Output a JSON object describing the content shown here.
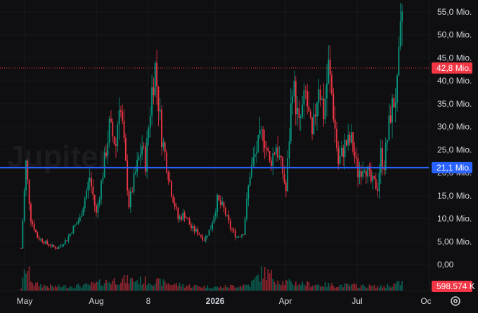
{
  "chart_data": {
    "type": "candlestick",
    "x_ticks": [
      "May",
      "Aug",
      "8",
      "2026",
      "Apr",
      "Jul",
      "Oc"
    ],
    "y_ticks": [
      "55,0 Mio.",
      "50,0 Mio.",
      "45,0 Mio.",
      "40,0 Mio.",
      "35,0 Mio.",
      "30,0 Mio.",
      "25,0 Mio.",
      "20,0 Mio.",
      "15,0 Mio.",
      "10,0 Mio.",
      "5,00 Mio.",
      "0,00"
    ],
    "ylim": [
      -5.5,
      56.5
    ],
    "unit": "Mio.",
    "price_marker": {
      "label": "42,8 Mio.",
      "value": 42.8,
      "color": "#f23645"
    },
    "level_line": {
      "label": "21,1 Mio.",
      "value": 21.1,
      "color": "#2962ff"
    },
    "volume_label": {
      "label": "598.574 K",
      "color": "#f23645"
    },
    "watermark": "Jupiter",
    "up_color": "#089981",
    "down_color": "#f23645",
    "series_anchors": [
      [
        0,
        3.5
      ],
      [
        3,
        22
      ],
      [
        6,
        10
      ],
      [
        10,
        6
      ],
      [
        16,
        4.5
      ],
      [
        22,
        3.5
      ],
      [
        28,
        5.5
      ],
      [
        32,
        8
      ],
      [
        36,
        10
      ],
      [
        42,
        19
      ],
      [
        46,
        11
      ],
      [
        50,
        20
      ],
      [
        54,
        30
      ],
      [
        58,
        26
      ],
      [
        60,
        36
      ],
      [
        62,
        30
      ],
      [
        66,
        13
      ],
      [
        70,
        20
      ],
      [
        74,
        26
      ],
      [
        76,
        22
      ],
      [
        80,
        38
      ],
      [
        82,
        43
      ],
      [
        86,
        28
      ],
      [
        88,
        24
      ],
      [
        92,
        16
      ],
      [
        96,
        10
      ],
      [
        100,
        11
      ],
      [
        104,
        8
      ],
      [
        108,
        7
      ],
      [
        112,
        5.5
      ],
      [
        116,
        8
      ],
      [
        120,
        14
      ],
      [
        124,
        12
      ],
      [
        128,
        8
      ],
      [
        132,
        6
      ],
      [
        136,
        7
      ],
      [
        140,
        20
      ],
      [
        144,
        25
      ],
      [
        148,
        29
      ],
      [
        152,
        22
      ],
      [
        156,
        26
      ],
      [
        160,
        20
      ],
      [
        162,
        16
      ],
      [
        166,
        40
      ],
      [
        170,
        30
      ],
      [
        174,
        37
      ],
      [
        178,
        27
      ],
      [
        182,
        40
      ],
      [
        185,
        33
      ],
      [
        188,
        43
      ],
      [
        190,
        37
      ],
      [
        194,
        22
      ],
      [
        198,
        26
      ],
      [
        202,
        27
      ],
      [
        206,
        20
      ],
      [
        210,
        22
      ],
      [
        214,
        18
      ],
      [
        218,
        17
      ],
      [
        220,
        24
      ],
      [
        222,
        22
      ],
      [
        226,
        33
      ],
      [
        230,
        38
      ],
      [
        233,
        55
      ]
    ],
    "volume_anchors": [
      [
        0,
        0.06
      ],
      [
        3,
        0.55
      ],
      [
        8,
        0.15
      ],
      [
        20,
        0.09
      ],
      [
        40,
        0.12
      ],
      [
        60,
        0.26
      ],
      [
        80,
        0.22
      ],
      [
        100,
        0.12
      ],
      [
        120,
        0.08
      ],
      [
        140,
        0.14
      ],
      [
        148,
        0.45
      ],
      [
        160,
        0.2
      ],
      [
        180,
        0.14
      ],
      [
        200,
        0.12
      ],
      [
        220,
        0.09
      ],
      [
        233,
        0.18
      ]
    ],
    "bar_count": 234
  }
}
